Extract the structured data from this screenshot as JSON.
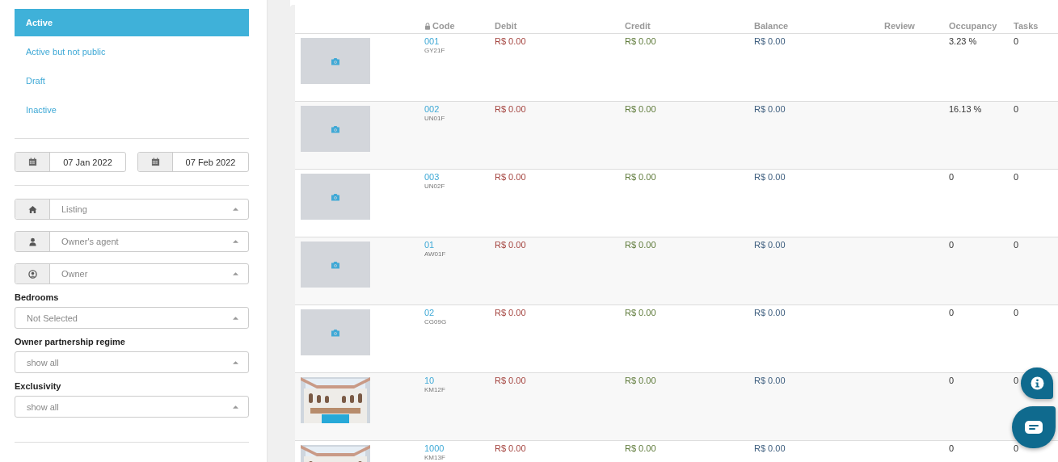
{
  "status_filters": [
    {
      "label": "Active",
      "selected": true
    },
    {
      "label": "Active but not public",
      "selected": false
    },
    {
      "label": "Draft",
      "selected": false
    },
    {
      "label": "Inactive",
      "selected": false
    }
  ],
  "date_range": {
    "start": "07 Jan 2022",
    "end": "07 Feb 2022"
  },
  "icon_selects": [
    {
      "kind": "home",
      "placeholder": "Listing"
    },
    {
      "kind": "person",
      "placeholder": "Owner's agent"
    },
    {
      "kind": "user-circle",
      "placeholder": "Owner"
    }
  ],
  "labeled_selects": [
    {
      "label": "Bedrooms",
      "value": "Not Selected"
    },
    {
      "label": "Owner partnership regime",
      "value": "show all"
    },
    {
      "label": "Exclusivity",
      "value": "show all"
    }
  ],
  "table": {
    "columns": [
      "Code",
      "Debit",
      "Credit",
      "Balance",
      "Review",
      "Occupancy",
      "Tasks"
    ],
    "rows": [
      {
        "kind": "placeholder",
        "code": "001",
        "sub_code": "GY21F",
        "debit": "R$ 0.00",
        "credit": "R$ 0.00",
        "balance": "R$ 0.00",
        "occupancy": "3.23 %",
        "tasks": "0"
      },
      {
        "kind": "placeholder",
        "code": "002",
        "sub_code": "UN01F",
        "debit": "R$ 0.00",
        "credit": "R$ 0.00",
        "balance": "R$ 0.00",
        "occupancy": "16.13 %",
        "tasks": "0"
      },
      {
        "kind": "placeholder",
        "code": "003",
        "sub_code": "UN02F",
        "debit": "R$ 0.00",
        "credit": "R$ 0.00",
        "balance": "R$ 0.00",
        "occupancy": "0",
        "tasks": "0"
      },
      {
        "kind": "placeholder",
        "code": "01",
        "sub_code": "AW01F",
        "debit": "R$ 0.00",
        "credit": "R$ 0.00",
        "balance": "R$ 0.00",
        "occupancy": "0",
        "tasks": "0"
      },
      {
        "kind": "placeholder",
        "code": "02",
        "sub_code": "CG09G",
        "debit": "R$ 0.00",
        "credit": "R$ 0.00",
        "balance": "R$ 0.00",
        "occupancy": "0",
        "tasks": "0"
      },
      {
        "kind": "picture",
        "code": "10",
        "sub_code": "KM12F",
        "debit": "R$ 0.00",
        "credit": "R$ 0.00",
        "balance": "R$ 0.00",
        "occupancy": "0",
        "tasks": "0"
      },
      {
        "kind": "picture",
        "code": "1000",
        "sub_code": "KM13F",
        "debit": "R$ 0.00",
        "credit": "R$ 0.00",
        "balance": "R$ 0.00",
        "occupancy": "0",
        "tasks": "0"
      }
    ]
  }
}
